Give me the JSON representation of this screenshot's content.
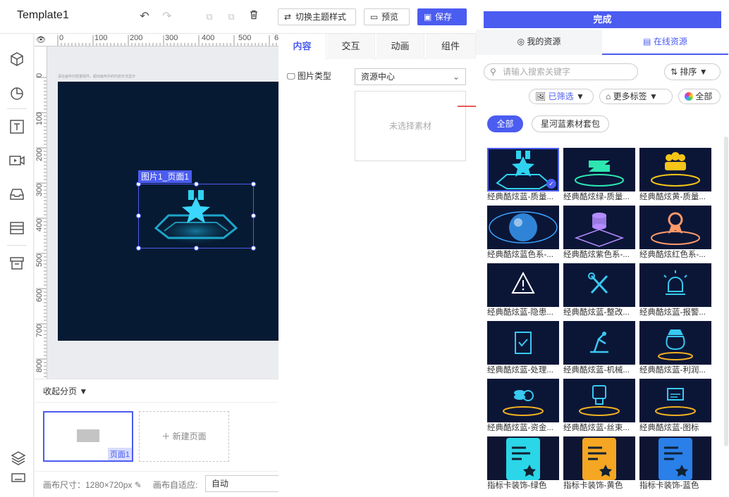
{
  "app": {
    "title": "Template1"
  },
  "toolbar": {
    "switch_theme": "切换主题样式",
    "preview": "预览",
    "save": "保存"
  },
  "canvas": {
    "ruler_h_ticks": [
      "0",
      "100",
      "200",
      "300",
      "400",
      "500",
      "6"
    ],
    "ruler_v_ticks": [
      "0",
      "100",
      "200",
      "300",
      "400",
      "500",
      "600",
      "700",
      "800"
    ],
    "hint": "请在画布内放置组件，超出画布外的内容无法显示",
    "selection_label": "图片1_页面1"
  },
  "pages": {
    "collapse_label": "收起分页",
    "page1_label": "页面1",
    "new_page_label": "新建页面",
    "canvas_size": "画布尺寸：1280×720px",
    "canvas_fit_label": "画布自适应:",
    "canvas_fit_value": "自动"
  },
  "props": {
    "tabs": [
      "内容",
      "交互",
      "动画",
      "组件"
    ],
    "image_type_label": "图片类型",
    "image_type_value": "资源中心",
    "empty_text": "未选择素材"
  },
  "resources": {
    "done": "完成",
    "tab_my": "我的资源",
    "tab_online": "在线资源",
    "search_placeholder": "请输入搜索关键字",
    "sort": "排序",
    "filtered": "已筛选",
    "more_tags": "更多标签",
    "all_colors": "全部",
    "cat_all": "全部",
    "cat_pack": "星河蓝素材套包",
    "items": [
      {
        "caption": "经典酷炫蓝-质量...",
        "icon": "badge-star-icon",
        "color": "#2fd3f0",
        "selected": true
      },
      {
        "caption": "经典酷炫绿-质量...",
        "icon": "handshake-icon",
        "color": "#2ee6b0",
        "selected": false
      },
      {
        "caption": "经典酷炫黄-质量...",
        "icon": "people-icon",
        "color": "#f5c518",
        "selected": false
      },
      {
        "caption": "经典酷炫蓝色系-...",
        "icon": "sphere-icon",
        "color": "#3aa0ff",
        "selected": false
      },
      {
        "caption": "经典酷炫紫色系-...",
        "icon": "database-icon",
        "color": "#b48cff",
        "selected": false
      },
      {
        "caption": "经典酷炫红色系-...",
        "icon": "medal-icon",
        "color": "#ff9a6a",
        "selected": false
      },
      {
        "caption": "经典酷炫蓝-隐患...",
        "icon": "warning-icon",
        "color": "#38c8f0",
        "selected": false
      },
      {
        "caption": "经典酷炫蓝-整改...",
        "icon": "tools-icon",
        "color": "#38c8f0",
        "selected": false
      },
      {
        "caption": "经典酷炫蓝-报警...",
        "icon": "alarm-icon",
        "color": "#38c8f0",
        "selected": false
      },
      {
        "caption": "经典酷炫蓝-处理...",
        "icon": "clipboard-icon",
        "color": "#38c8f0",
        "selected": false
      },
      {
        "caption": "经典酷炫蓝-机械...",
        "icon": "robot-arm-icon",
        "color": "#38c8f0",
        "selected": false
      },
      {
        "caption": "经典酷炫蓝-利润...",
        "icon": "money-bag-icon",
        "color": "#38c8f0",
        "selected": false
      },
      {
        "caption": "经典酷炫蓝-资金...",
        "icon": "coins-icon",
        "color": "#38c8f0",
        "selected": false
      },
      {
        "caption": "经典酷炫蓝-丝束...",
        "icon": "spool-icon",
        "color": "#38c8f0",
        "selected": false
      },
      {
        "caption": "经典酷炫蓝-图标",
        "icon": "monitor-icon",
        "color": "#38c8f0",
        "selected": false
      },
      {
        "caption": "指标卡装饰-绿色",
        "icon": "card-green-icon",
        "color": "#2ad6e8",
        "selected": false
      },
      {
        "caption": "指标卡装饰-黄色",
        "icon": "card-yellow-icon",
        "color": "#f5a623",
        "selected": false
      },
      {
        "caption": "指标卡装饰-蓝色",
        "icon": "card-blue-icon",
        "color": "#2a7fe8",
        "selected": false
      }
    ]
  }
}
